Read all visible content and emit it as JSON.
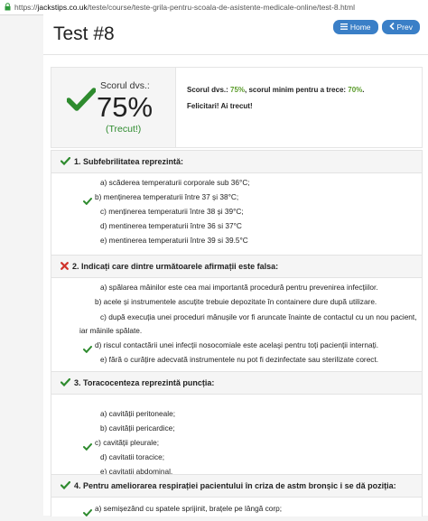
{
  "browser": {
    "url_prefix": "https://",
    "url_host": "jackstips.co.uk",
    "url_path": "/teste/course/teste-grila-pentru-scoala-de-asistente-medicale-online/test-8.html"
  },
  "page": {
    "title": "Test #8",
    "home_label": "Home",
    "prev_label": "Prev"
  },
  "score": {
    "label": "Scorul dvs.:",
    "percent": "75%",
    "status": "(Trecut!)",
    "line_label": "Scorul dvs.: ",
    "line_value": "75%",
    "line_mid": ", scorul minim pentru a trece: ",
    "line_min": "70%",
    "line_end": ".",
    "congrats": "Felicitari! Ai trecut!"
  },
  "colors": {
    "correct": "#2e8b2e",
    "wrong": "#d0342c",
    "button": "#3a7fc7"
  },
  "questions": [
    {
      "icon": "check-icon",
      "title": "1. Subfebrilitatea reprezintă:",
      "options": [
        "a) scăderea temperaturii corporale sub 36°C;",
        "b) menținerea temperaturii între 37 și 38°C;",
        "c) menținerea temperaturii între 38 și 39°C;",
        "d) mentinerea temperaturii între 36 si 37°C",
        "e) mentinerea temperaturii între 39 si 39.5°C"
      ]
    },
    {
      "icon": "cross-icon",
      "title": "2. Indicați care dintre următoarele afirmații este falsa:",
      "options": [
        "a) spălarea mâinilor este cea mai importantă procedură pentru prevenirea infecțiilor.",
        "b) acele și instrumentele ascuțite trebuie depozitate în containere dure după utilizare.",
        "c) după execuția unei proceduri mânușile vor fi aruncate înainte de contactul cu un nou pacient,",
        "iar mâinile spălate.",
        "d) riscul contactării unei infecții nosocomiale este acelaşi pentru toți pacienții internați.",
        "e) fără o curățire adecvată instrumentele nu pot fi dezinfectate sau sterilizate corect."
      ]
    },
    {
      "icon": "check-icon",
      "title": "3. Toracocenteza reprezintă puncția:",
      "options": [
        "a) cavității peritoneale;",
        "b) cavității pericardice;",
        "c) cavității pleurale;",
        "d) cavitatii toracice;",
        "e) cavitatii abdominal."
      ]
    },
    {
      "icon": "check-icon",
      "title": "4. Pentru ameliorarea respirației pacientului în criza de astm bronșic i se dă poziția:",
      "options": [
        "a) semișezând cu spatele sprijinit, brațele pe lângă corp;"
      ]
    }
  ]
}
